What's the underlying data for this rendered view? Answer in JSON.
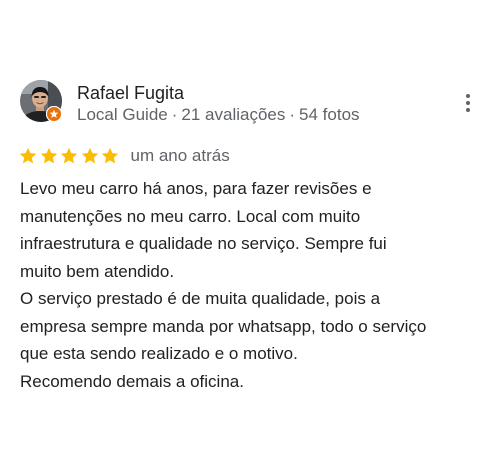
{
  "review": {
    "author": {
      "name": "Rafael Fugita",
      "role": "Local Guide",
      "separator": "·",
      "reviews_count": "21 avaliações",
      "photos_count": "54 fotos",
      "avatar_icon": "user-avatar-photo",
      "badge_icon": "local-guide-star-badge"
    },
    "menu_icon": "more-vert-icon",
    "rating": {
      "stars": 5,
      "max_stars": 5,
      "star_color": "#fbbc04",
      "date": "um ano atrás"
    },
    "text_lines": [
      "Levo meu carro há anos, para fazer revisões e",
      "manutenções no meu carro. Local com muito",
      "infraestrutura e qualidade no serviço. Sempre fui",
      "muito bem atendido.",
      "O serviço prestado é de muita qualidade, pois a",
      "empresa sempre manda por whatsapp, todo o serviço",
      "que esta sendo realizado e o motivo.",
      "Recomendo demais a oficina."
    ]
  }
}
